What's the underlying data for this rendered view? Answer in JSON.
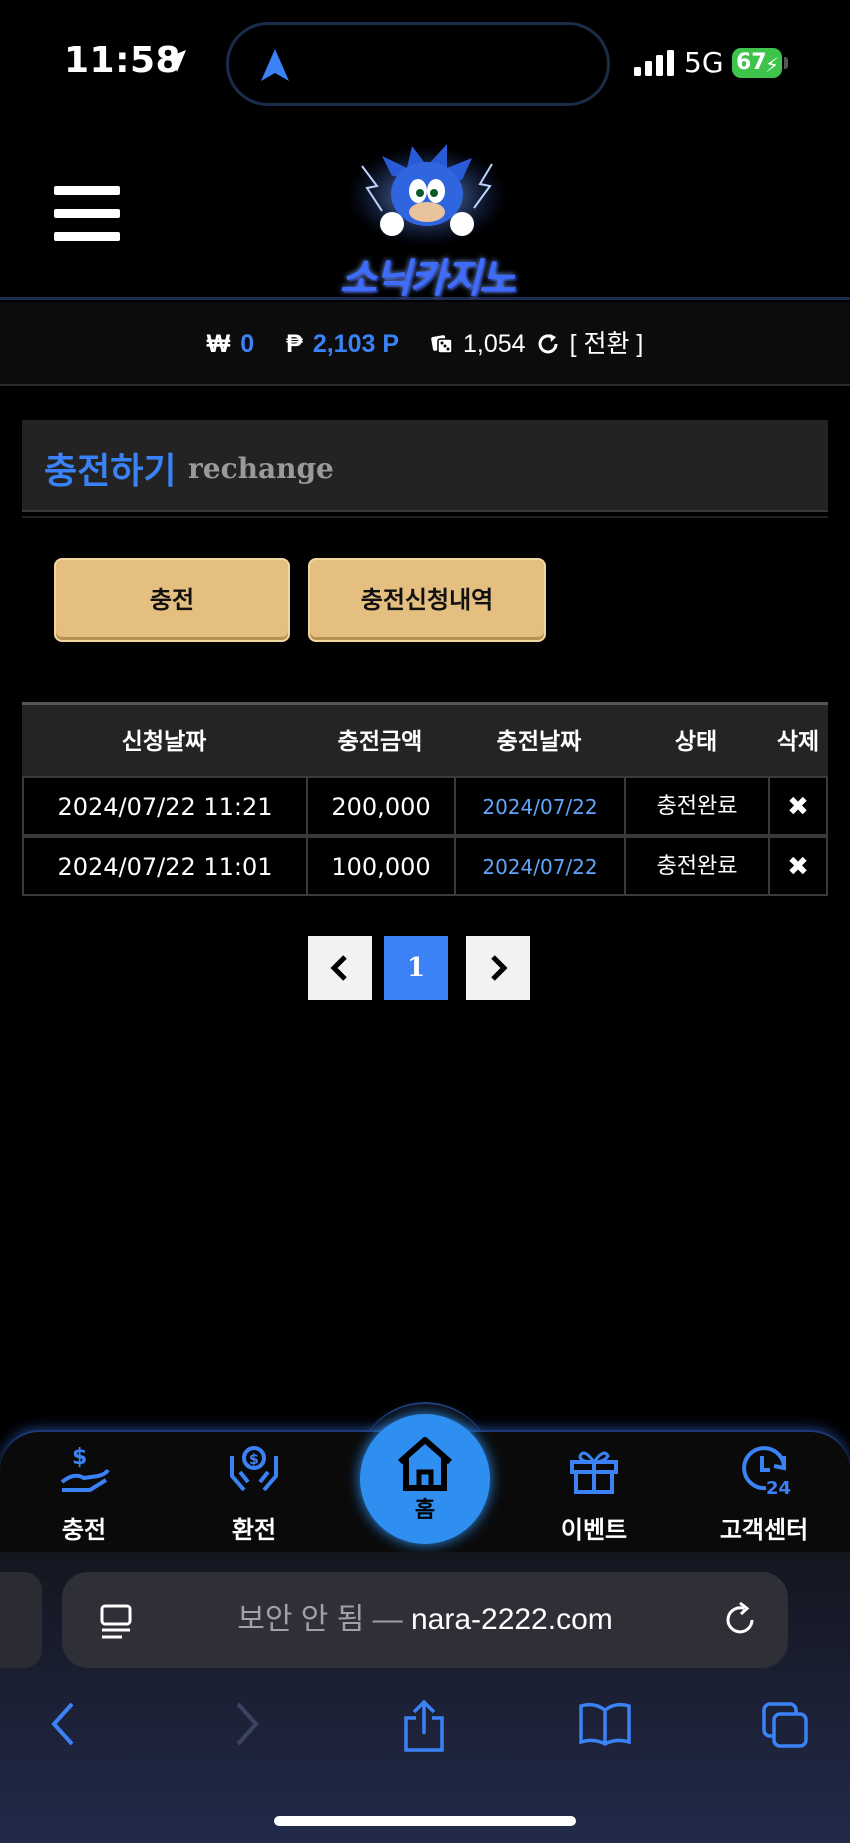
{
  "status_bar": {
    "time": "11:58",
    "network": "5G",
    "battery": "67"
  },
  "header": {
    "logo_text": "소닉카지노",
    "menu_icon": "hamburger-icon"
  },
  "balance": {
    "won_symbol": "₩",
    "won_value": "0",
    "point_symbol": "₱",
    "point_value": "2,103 P",
    "chips_value": "1,054",
    "convert_label": "[ 전환 ]"
  },
  "section": {
    "title_ko": "충전하기",
    "title_en": "rechange"
  },
  "buttons": {
    "charge": "충전",
    "history": "충전신청내역"
  },
  "table": {
    "headers": [
      "신청날짜",
      "충전금액",
      "충전날짜",
      "상태",
      "삭제"
    ],
    "rows": [
      {
        "request_date": "2024/07/22 11:21",
        "amount": "200,000",
        "charge_date": "2024/07/22",
        "status": "충전완료",
        "delete": "✖"
      },
      {
        "request_date": "2024/07/22 11:01",
        "amount": "100,000",
        "charge_date": "2024/07/22",
        "status": "충전완료",
        "delete": "✖"
      }
    ]
  },
  "pagination": {
    "current": "1"
  },
  "bottom_nav": {
    "charge": "충전",
    "exchange": "환전",
    "home": "홈",
    "event": "이벤트",
    "support": "고객센터"
  },
  "safari": {
    "insecure_label": "보안 안 됨 —",
    "domain": "nara-2222.com"
  },
  "colors": {
    "accent": "#3b82f6",
    "gold": "#e4bf7f",
    "home": "#2e8ff0"
  }
}
